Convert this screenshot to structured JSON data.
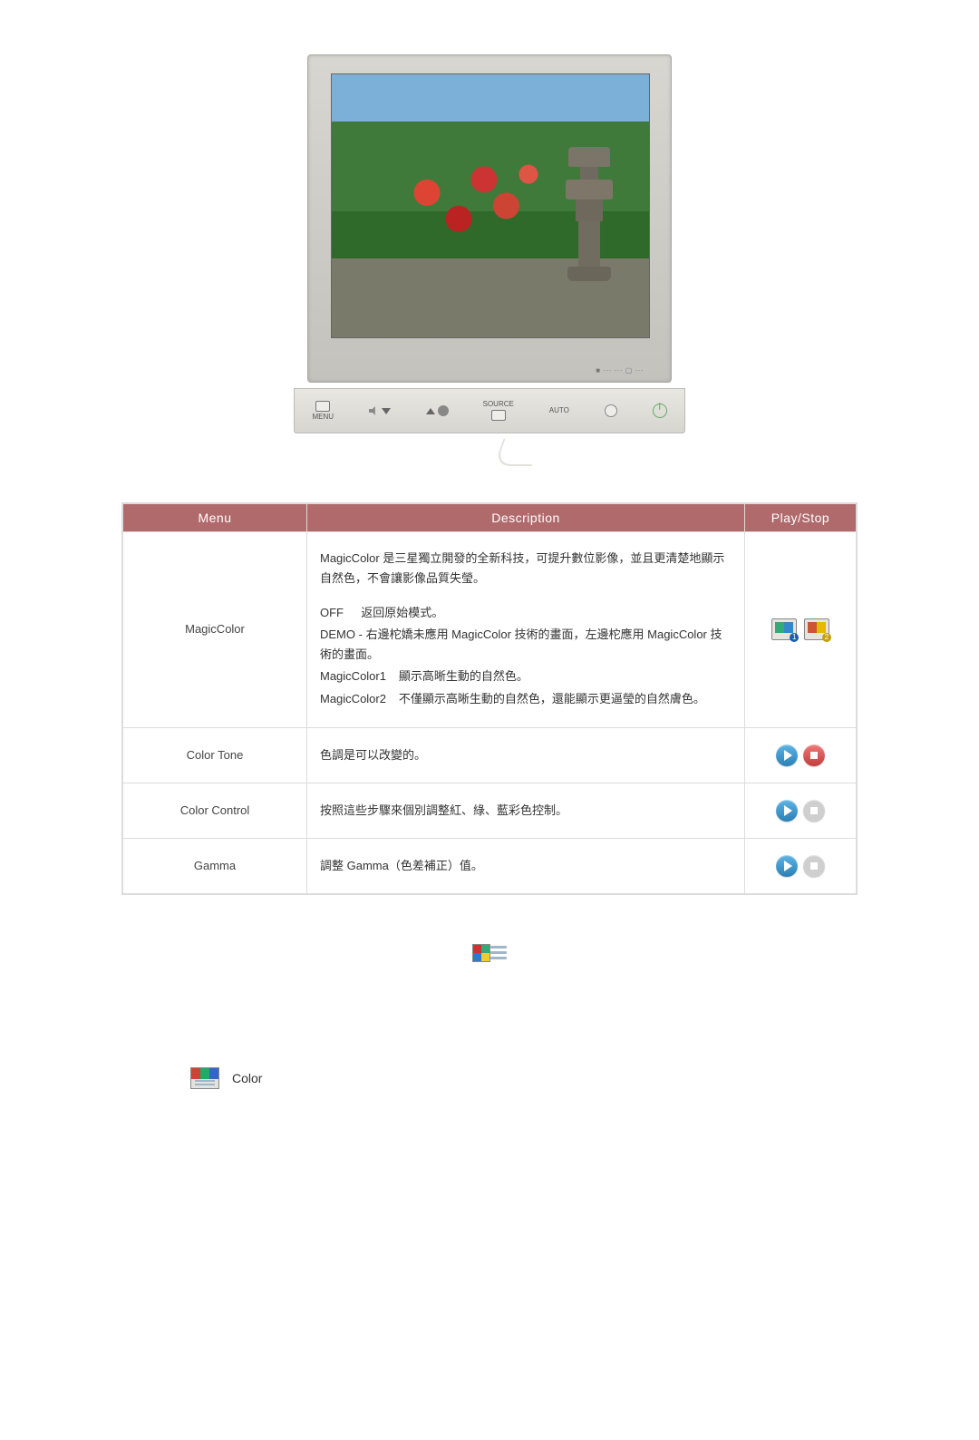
{
  "monitor": {
    "brand_area": "■ ··· ··· ▢ ···"
  },
  "buttons": {
    "menu_icon_label": "",
    "menu_text": "MENU",
    "source_text": "SOURCE",
    "auto_text": "AUTO"
  },
  "table": {
    "headers": {
      "menu": "Menu",
      "description": "Description",
      "playstop": "Play/Stop"
    },
    "rows": [
      {
        "menu": "MagicColor",
        "desc_intro": "MagicColor 是三星獨立開發的全新科技，可提升數位影像，並且更清楚地顯示自然色，不會讓影像品質失瑩。",
        "opts": [
          {
            "key": "OFF",
            "text": "返回原始模式。"
          },
          {
            "key": "DEMO - ",
            "text": "右邊柁嬌未應用 MagicColor 技術的畫面，左邊柁應用 MagicColor 技術的畫面。"
          },
          {
            "key": "MagicColor1",
            "text": "顯示高晰生動的自然色。"
          },
          {
            "key": "MagicColor2",
            "text": "不僅顯示高晰生動的自然色，還能顯示更逼瑩的自然膚色。"
          }
        ]
      },
      {
        "menu": "Color Tone",
        "desc": "色調是可以改變的。"
      },
      {
        "menu": "Color Control",
        "desc": "按照這些步驟來個別調整紅、綠、藍彩色控制。"
      },
      {
        "menu": "Gamma",
        "desc": "調整 Gamma（色差補正）值。"
      }
    ]
  },
  "bottom": {
    "color_label": "Color"
  }
}
